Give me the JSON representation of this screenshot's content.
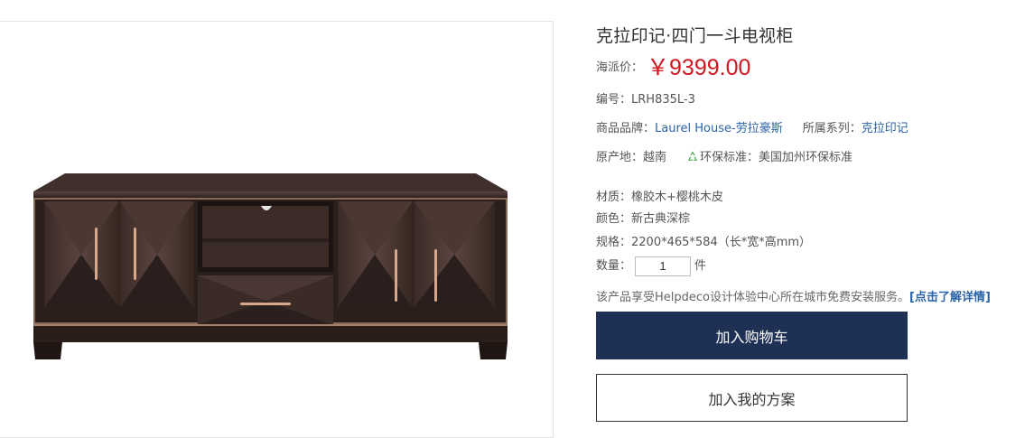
{
  "product": {
    "title": "克拉印记·四门一斗电视柜",
    "price_label": "海派价：",
    "price_value": "￥9399.00",
    "sku_label": "编号：",
    "sku_value": "LRH835L-3",
    "brand_label": "商品品牌：",
    "brand_value": "Laurel House-劳拉豪斯",
    "series_label": "所属系列：",
    "series_value": "克拉印记",
    "origin_label": "原产地：",
    "origin_value": "越南",
    "eco_label": "环保标准：",
    "eco_value": "美国加州环保标准",
    "material_label": "材质：",
    "material_value": "橡胶木+樱桃木皮",
    "color_label": "颜色：",
    "color_value": "新古典深棕",
    "spec_label": "规格：",
    "spec_value": "2200*465*584（长*宽*高mm）",
    "qty_label": "数量：",
    "qty_value": "1",
    "qty_unit": "件",
    "service_text": "该产品享受Helpdeco设计体验中心所在城市免费安装服务。",
    "service_link": "[点击了解详情]"
  },
  "actions": {
    "add_to_cart": "加入购物车",
    "add_to_plan": "加入我的方案"
  },
  "colors": {
    "price": "#d0161f",
    "link": "#2a63a8",
    "primary_button": "#1e3054",
    "eco_icon": "#3aa33a"
  },
  "icons": {
    "eco": "recycle-icon"
  }
}
